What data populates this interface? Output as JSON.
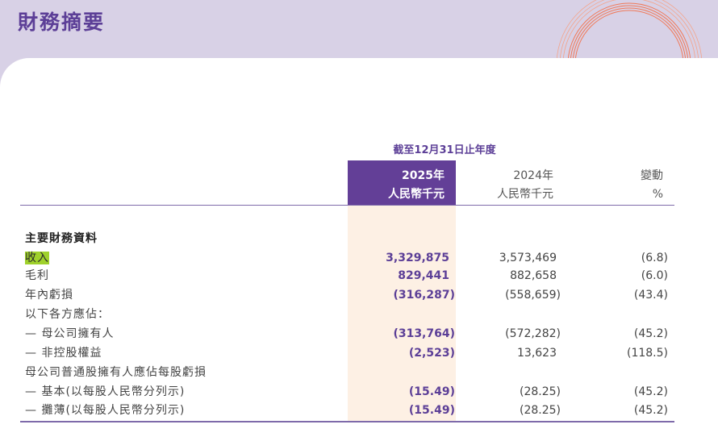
{
  "page": {
    "title": "財務摘要"
  },
  "table": {
    "period_header": "截至12月31日止年度",
    "columns": [
      {
        "year": "2025年",
        "unit": "人民幣千元"
      },
      {
        "year": "2024年",
        "unit": "人民幣千元"
      },
      {
        "year": "變動",
        "unit": "%"
      }
    ],
    "section_title": "主要財務資料",
    "rows": [
      {
        "label": "收入",
        "v2025": "3,329,875",
        "v2024": "3,573,469",
        "change": "(6.8)"
      },
      {
        "label": "毛利",
        "v2025": "829,441",
        "v2024": "882,658",
        "change": "(6.0)"
      },
      {
        "label": "年內虧損",
        "v2025": "(316,287)",
        "v2024": "(558,659)",
        "change": "(43.4)"
      },
      {
        "label": "以下各方應佔：",
        "v2025": "",
        "v2024": "",
        "change": ""
      },
      {
        "label": "— 母公司擁有人",
        "v2025": "(313,764)",
        "v2024": "(572,282)",
        "change": "(45.2)"
      },
      {
        "label": "— 非控股權益",
        "v2025": "(2,523)",
        "v2024": "13,623",
        "change": "(118.5)"
      },
      {
        "label": "母公司普通股擁有人應佔每股虧損",
        "v2025": "",
        "v2024": "",
        "change": ""
      },
      {
        "label": "— 基本(以每股人民幣分列示)",
        "v2025": "(15.49)",
        "v2024": "(28.25)",
        "change": "(45.2)"
      },
      {
        "label": "— 攤薄(以每股人民幣分列示)",
        "v2025": "(15.49)",
        "v2024": "(28.25)",
        "change": "(45.2)"
      }
    ]
  },
  "colors": {
    "brand_purple": "#5c3f97",
    "header_fill": "#633f97",
    "column_highlight": "#fdf0e4",
    "text_highlight": "#9fd12b",
    "decoration_orange": "#f07a5a"
  }
}
